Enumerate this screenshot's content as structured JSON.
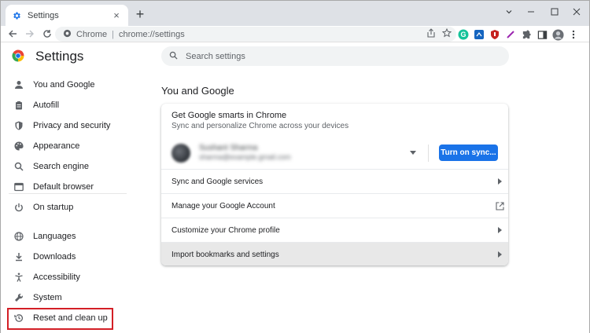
{
  "tab": {
    "title": "Settings",
    "close_symbol": "×",
    "new_tab_symbol": "+"
  },
  "window": {
    "minimize_symbol": "⌄",
    "restore_symbol": "—",
    "maximize_symbol": "☐",
    "close_symbol": "✕"
  },
  "omnibox": {
    "site": "Chrome",
    "separator": "|",
    "url": "chrome://settings"
  },
  "header": {
    "title": "Settings",
    "search_placeholder": "Search settings"
  },
  "sidebar": {
    "items": [
      {
        "label": "You and Google",
        "icon": "person-icon"
      },
      {
        "label": "Autofill",
        "icon": "clipboard-icon"
      },
      {
        "label": "Privacy and security",
        "icon": "shield-icon"
      },
      {
        "label": "Appearance",
        "icon": "palette-icon"
      },
      {
        "label": "Search engine",
        "icon": "search-icon"
      },
      {
        "label": "Default browser",
        "icon": "browser-window-icon"
      },
      {
        "label": "On startup",
        "icon": "power-icon"
      },
      {
        "label": "Languages",
        "icon": "globe-icon"
      },
      {
        "label": "Downloads",
        "icon": "download-icon"
      },
      {
        "label": "Accessibility",
        "icon": "accessibility-icon"
      },
      {
        "label": "System",
        "icon": "wrench-icon"
      },
      {
        "label": "Reset and clean up",
        "icon": "restore-icon"
      }
    ],
    "highlighted_item": "Reset and clean up",
    "highlight_color": "#d31f26"
  },
  "main": {
    "section_title": "You and Google",
    "smarts_title": "Get Google smarts in Chrome",
    "smarts_subtitle": "Sync and personalize Chrome across your devices",
    "account": {
      "name": "Sushant Sharma",
      "email": "sharma@example.gmail.com",
      "blurred": true
    },
    "turn_on_sync_label": "Turn on sync...",
    "rows": [
      {
        "label": "Sync and Google services",
        "icon": "chevron-right-icon"
      },
      {
        "label": "Manage your Google Account",
        "icon": "external-link-icon"
      },
      {
        "label": "Customize your Chrome profile",
        "icon": "chevron-right-icon"
      },
      {
        "label": "Import bookmarks and settings",
        "icon": "chevron-right-icon"
      }
    ]
  },
  "colors": {
    "accent": "#1a73e8",
    "tab_strip": "#dee1e6",
    "omnibox": "#f1f3f4"
  }
}
